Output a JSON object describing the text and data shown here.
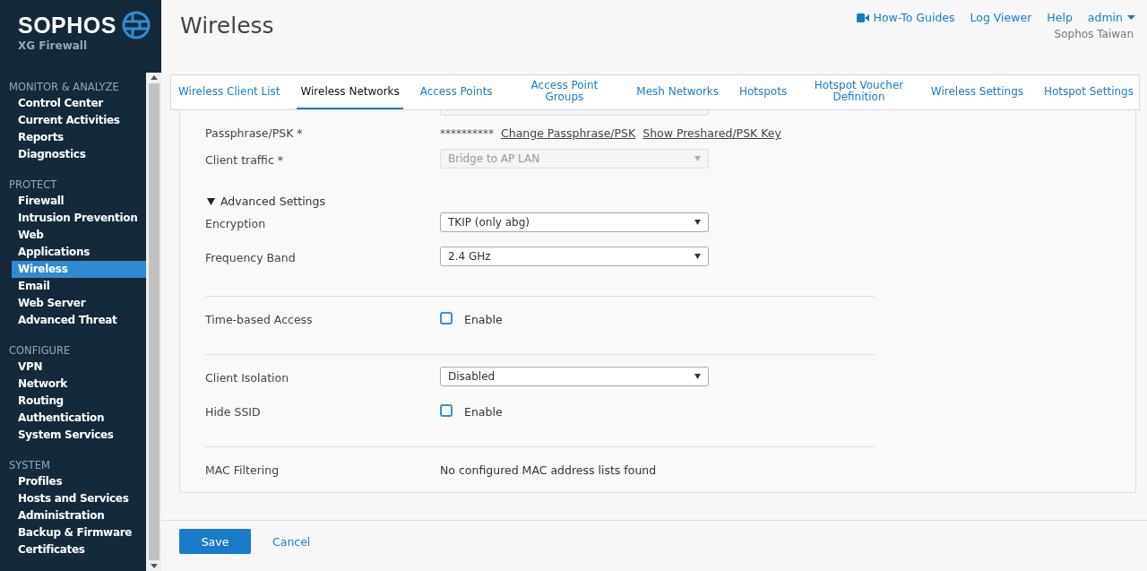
{
  "brand": {
    "name": "SOPHOS",
    "product": "XG Firewall"
  },
  "sidebar": {
    "sections": [
      {
        "title": "MONITOR & ANALYZE",
        "items": [
          {
            "label": "Control Center",
            "selected": false
          },
          {
            "label": "Current Activities",
            "selected": false
          },
          {
            "label": "Reports",
            "selected": false
          },
          {
            "label": "Diagnostics",
            "selected": false
          }
        ]
      },
      {
        "title": "PROTECT",
        "items": [
          {
            "label": "Firewall",
            "selected": false
          },
          {
            "label": "Intrusion Prevention",
            "selected": false
          },
          {
            "label": "Web",
            "selected": false
          },
          {
            "label": "Applications",
            "selected": false
          },
          {
            "label": "Wireless",
            "selected": true
          },
          {
            "label": "Email",
            "selected": false
          },
          {
            "label": "Web Server",
            "selected": false
          },
          {
            "label": "Advanced Threat",
            "selected": false
          }
        ]
      },
      {
        "title": "CONFIGURE",
        "items": [
          {
            "label": "VPN",
            "selected": false
          },
          {
            "label": "Network",
            "selected": false
          },
          {
            "label": "Routing",
            "selected": false
          },
          {
            "label": "Authentication",
            "selected": false
          },
          {
            "label": "System Services",
            "selected": false
          }
        ]
      },
      {
        "title": "SYSTEM",
        "items": [
          {
            "label": "Profiles",
            "selected": false
          },
          {
            "label": "Hosts and Services",
            "selected": false
          },
          {
            "label": "Administration",
            "selected": false
          },
          {
            "label": "Backup & Firmware",
            "selected": false
          },
          {
            "label": "Certificates",
            "selected": false
          }
        ]
      }
    ]
  },
  "page": {
    "title": "Wireless"
  },
  "top_links": [
    {
      "label": "How-To Guides",
      "kind": "video"
    },
    {
      "label": "Log Viewer",
      "kind": "plain"
    },
    {
      "label": "Help",
      "kind": "plain"
    },
    {
      "label": "admin",
      "kind": "menu"
    }
  ],
  "organization": "Sophos Taiwan",
  "tabs": [
    {
      "label": "Wireless Client List",
      "selected": false
    },
    {
      "label": "Wireless Networks",
      "selected": true
    },
    {
      "label": "Access Points",
      "selected": false
    },
    {
      "label": "Access Point Groups",
      "selected": false
    },
    {
      "label": "Mesh Networks",
      "selected": false
    },
    {
      "label": "Hotspots",
      "selected": false
    },
    {
      "label": "Hotspot Voucher Definition",
      "selected": false
    },
    {
      "label": "Wireless Settings",
      "selected": false
    },
    {
      "label": "Hotspot Settings",
      "selected": false
    }
  ],
  "form": {
    "groups": [
      {
        "rows": [
          {
            "kind": "password",
            "label": "Passphrase/PSK *",
            "value": "**********",
            "links": [
              "Change Passphrase/PSK",
              "Show Preshared/PSK Key"
            ]
          },
          {
            "kind": "select",
            "label": "Client traffic *",
            "value": "Bridge to AP LAN",
            "disabled": true
          },
          {
            "kind": "section",
            "label": "Advanced Settings",
            "expanded": true
          },
          {
            "kind": "select",
            "label": "Encryption",
            "value": "TKIP (only abg)",
            "disabled": false
          },
          {
            "kind": "select",
            "label": "Frequency Band",
            "value": "2.4 GHz",
            "disabled": false
          }
        ]
      },
      {
        "rows": [
          {
            "kind": "checkbox",
            "label": "Time-based Access",
            "option": "Enable",
            "checked": false
          }
        ]
      },
      {
        "rows": [
          {
            "kind": "select",
            "label": "Client Isolation",
            "value": "Disabled",
            "disabled": false
          },
          {
            "kind": "checkbox",
            "label": "Hide SSID",
            "option": "Enable",
            "checked": false
          }
        ]
      },
      {
        "rows": [
          {
            "kind": "text",
            "label": "MAC Filtering",
            "value": "No configured MAC address lists found"
          }
        ]
      }
    ]
  },
  "buttons": [
    {
      "label": "Save",
      "kind": "primary"
    },
    {
      "label": "Cancel",
      "kind": "link"
    }
  ]
}
